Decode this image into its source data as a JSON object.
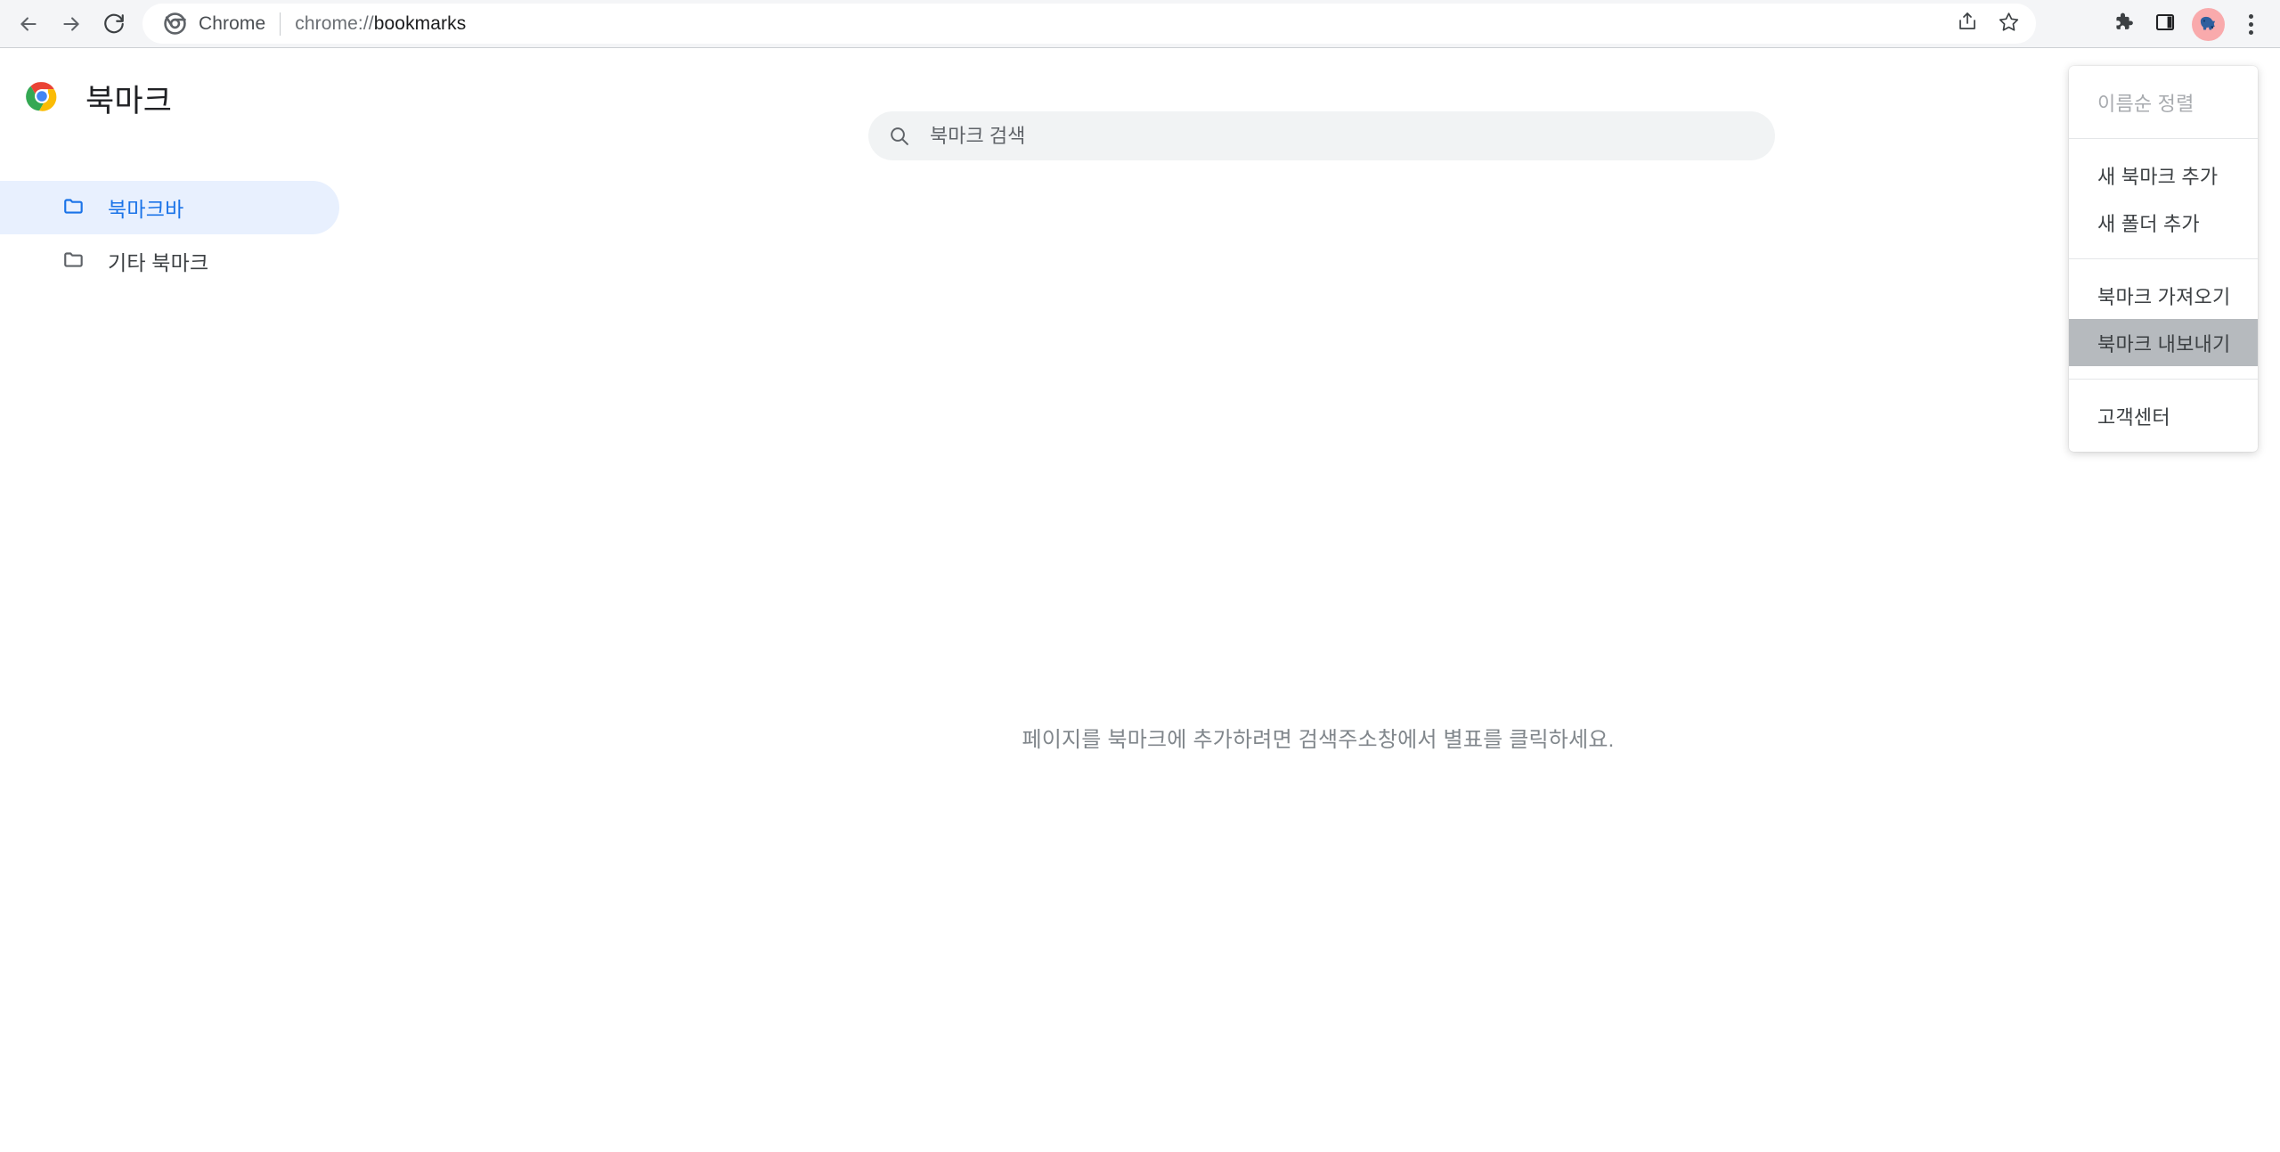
{
  "browser": {
    "nav": {
      "back_label": "Back",
      "forward_label": "Forward",
      "reload_label": "Reload"
    },
    "omnibox": {
      "chrome_label": "Chrome",
      "url_scheme": "chrome://",
      "url_host": "bookmarks",
      "full_url": "chrome://bookmarks",
      "share_label": "Share this page",
      "bookmark_star_label": "Bookmark this tab"
    },
    "toolbar": {
      "extensions_label": "Extensions",
      "side_panel_label": "Side panel",
      "profile_label": "Profile",
      "menu_label": "Customize and control Google Chrome"
    }
  },
  "bookmarks_page": {
    "title": "북마크",
    "search": {
      "placeholder": "북마크 검색",
      "value": ""
    },
    "folders": [
      {
        "label": "북마크바",
        "selected": true
      },
      {
        "label": "기타 북마크",
        "selected": false
      }
    ],
    "empty_state_text": "페이지를 북마크에 추가하려면 검색주소창에서 별표를 클릭하세요."
  },
  "menu": {
    "sections": [
      {
        "items": [
          {
            "label": "이름순 정렬",
            "state": "disabled"
          }
        ]
      },
      {
        "items": [
          {
            "label": "새 북마크 추가",
            "state": "normal"
          },
          {
            "label": "새 폴더 추가",
            "state": "normal"
          }
        ]
      },
      {
        "items": [
          {
            "label": "북마크 가져오기",
            "state": "normal"
          },
          {
            "label": "북마크 내보내기",
            "state": "highlighted"
          }
        ]
      },
      {
        "items": [
          {
            "label": "고객센터",
            "state": "normal"
          }
        ]
      }
    ]
  },
  "colors": {
    "accent_blue": "#1a73e8",
    "selected_bg": "#e8f0fe",
    "toolbar_bg": "#f4f5f7",
    "search_bg": "#f1f3f4",
    "menu_highlight": "#b6babe",
    "muted_text": "#80868b",
    "avatar_bg": "#f9aaac"
  }
}
